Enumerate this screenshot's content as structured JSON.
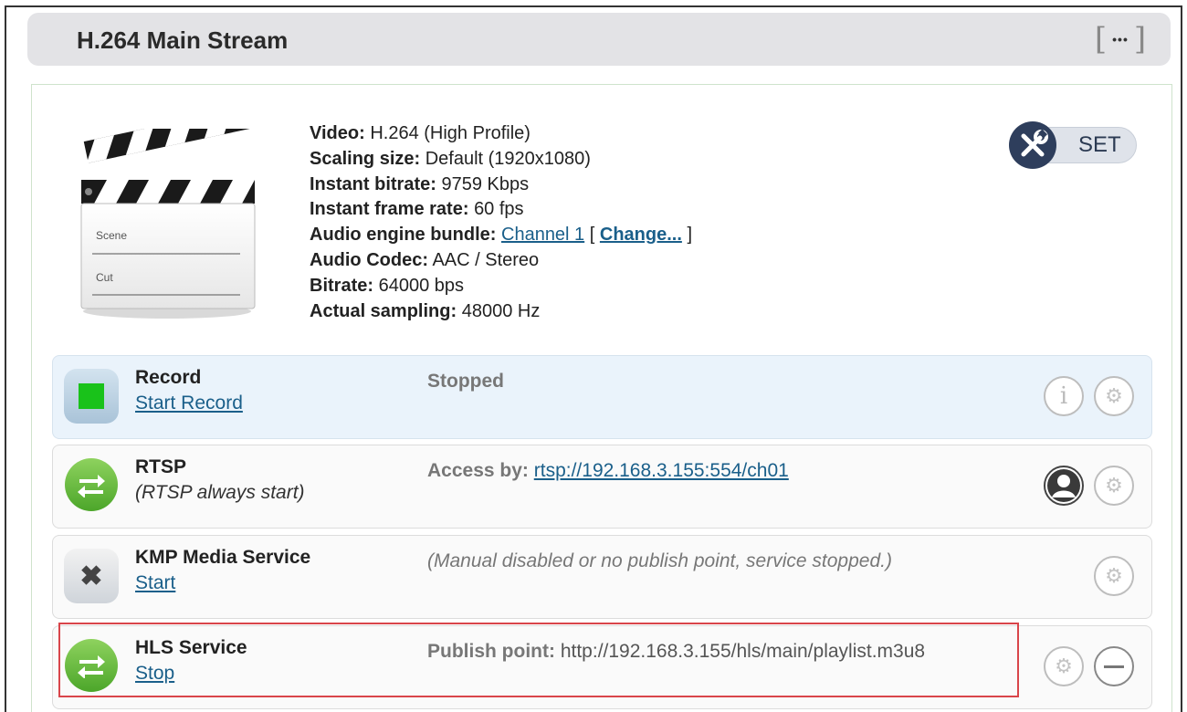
{
  "header": {
    "title": "H.264 Main Stream",
    "more_icon": "ellipsis-icon",
    "more_label": "•••"
  },
  "stream_info": {
    "video_label": "Video:",
    "video_value": "H.264 (High Profile)",
    "scaling_label": "Scaling size:",
    "scaling_value": "Default (1920x1080)",
    "bitrate_label": "Instant bitrate:",
    "bitrate_value": "9759 Kbps",
    "framerate_label": "Instant frame rate:",
    "framerate_value": "60 fps",
    "audio_bundle_label": "Audio engine bundle:",
    "audio_bundle_link": "Channel 1",
    "audio_bundle_open": "[",
    "audio_bundle_change": "Change...",
    "audio_bundle_close": "]",
    "audio_codec_label": "Audio Codec:",
    "audio_codec_value": "AAC / Stereo",
    "audio_bitrate_label": "Bitrate:",
    "audio_bitrate_value": "64000 bps",
    "sampling_label": "Actual sampling:",
    "sampling_value": "48000 Hz"
  },
  "clapper": {
    "scene_label": "Scene",
    "cut_label": "Cut"
  },
  "set_button": {
    "label": "SET",
    "icon": "wrench-screwdriver-icon"
  },
  "services": [
    {
      "title": "Record",
      "action": "Start Record",
      "status": "Stopped",
      "icon": "stop-icon",
      "icon_color": "#19c21a"
    },
    {
      "title": "RTSP",
      "subtitle": "(RTSP always start)",
      "status_label": "Access by:",
      "status_link": "rtsp://192.168.3.155:554/ch01",
      "icon": "transfer-arrows-icon"
    },
    {
      "title": "KMP Media Service",
      "action": "Start",
      "status": "(Manual disabled or no publish point, service stopped.)",
      "icon": "close-x-icon"
    },
    {
      "title": "HLS Service",
      "action": "Stop",
      "status_label": "Publish point:",
      "status_value": "http://192.168.3.155/hls/main/playlist.m3u8",
      "icon": "transfer-arrows-icon"
    }
  ]
}
